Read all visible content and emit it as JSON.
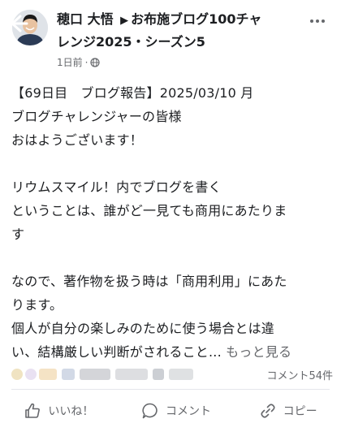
{
  "header": {
    "author": "穂口 大悟",
    "group_line1": "お布施ブログ100チャ",
    "group_line2": "レンジ2025・シーズン5",
    "arrow": "▶",
    "time": "1日前",
    "separator": "·"
  },
  "post": {
    "lines": [
      "【69日目　ブログ報告】2025/03/10 月",
      "ブログチャレンジャーの皆様",
      "おはようございます！",
      "",
      "リウムスマイル！内でブログを書く",
      "ということは、誰がど一見ても商用にあたりま",
      "す",
      "",
      "なので、著作物を扱う時は「商用利用」にあた",
      "ります。",
      "個人が自分の楽しみのために使う場合とは違",
      "い、結構厳しい判断がされること..."
    ],
    "see_more": "もっと見る"
  },
  "stats": {
    "comments": "コメント54件"
  },
  "actions": {
    "like": "いいね！",
    "comment": "コメント",
    "copy": "コピー"
  },
  "icons": {
    "back": "back-arrow-icon",
    "more": "more-options-icon",
    "privacy": "globe-icon",
    "like": "thumbs-up-icon",
    "comment": "comment-bubble-icon",
    "copy": "link-icon"
  }
}
